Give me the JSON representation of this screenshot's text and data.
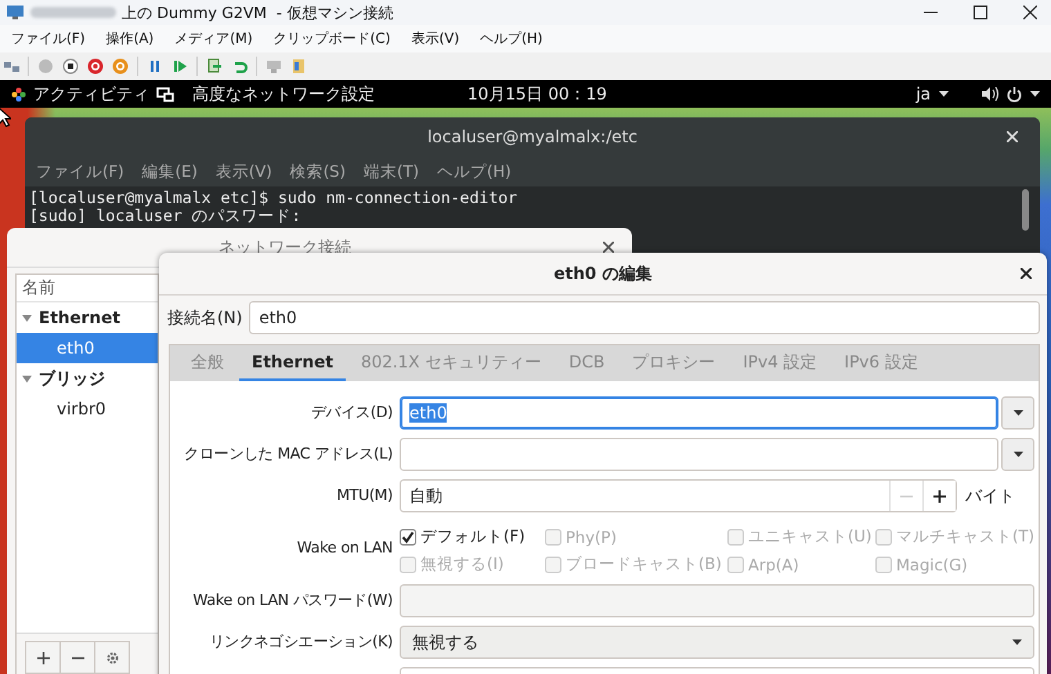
{
  "host_window": {
    "title": "上の Dummy G2VM  - 仮想マシン接続",
    "menu": [
      "ファイル(F)",
      "操作(A)",
      "メディア(M)",
      "クリップボード(C)",
      "表示(V)",
      "ヘルプ(H)"
    ]
  },
  "vm_top_bar": {
    "activities": "アクティビティ",
    "app": "高度なネットワーク設定",
    "clock": "10月15日 00：19",
    "input_method": "ja"
  },
  "terminal": {
    "title": "localuser@myalmalx:/etc",
    "menu": [
      "ファイル(F)",
      "編集(E)",
      "表示(V)",
      "検索(S)",
      "端末(T)",
      "ヘルプ(H)"
    ],
    "lines": [
      "[localuser@myalmalx etc]$ sudo nm-connection-editor",
      "[sudo] localuser のパスワード:"
    ]
  },
  "connections_window": {
    "title": "ネットワーク接続",
    "column": "名前",
    "groups": [
      {
        "label": "Ethernet",
        "expanded": true,
        "children": [
          {
            "label": "eth0",
            "selected": true
          }
        ]
      },
      {
        "label": "ブリッジ",
        "expanded": true,
        "children": [
          {
            "label": "virbr0",
            "selected": false
          }
        ]
      }
    ]
  },
  "edit_dialog": {
    "title": "eth0 の編集",
    "name_label": "接続名(N)",
    "name_value": "eth0",
    "tabs": [
      {
        "label": "全般",
        "selected": false
      },
      {
        "label": "Ethernet",
        "selected": true
      },
      {
        "label": "802.1X セキュリティー",
        "selected": false
      },
      {
        "label": "DCB",
        "selected": false
      },
      {
        "label": "プロキシー",
        "selected": false
      },
      {
        "label": "IPv4 設定",
        "selected": false
      },
      {
        "label": "IPv6 設定",
        "selected": false
      }
    ],
    "fields": [
      {
        "kind": "combo",
        "label": "デバイス(D)",
        "value": "eth0",
        "focused": true
      },
      {
        "kind": "combo",
        "label": "クローンした MAC アドレス(L)",
        "focused": false
      },
      {
        "kind": "spin",
        "label": "MTU(M)",
        "value": "自動",
        "unit": "バイト",
        "decrement_disabled": true
      },
      {
        "kind": "checks",
        "label": "Wake on LAN",
        "options": [
          {
            "label": "デフォルト(F)",
            "checked": true,
            "disabled": false
          },
          {
            "label": "Phy(P)",
            "checked": false,
            "disabled": true
          },
          {
            "label": "ユニキャスト(U)",
            "checked": false,
            "disabled": true
          },
          {
            "label": "マルチキャスト(T)",
            "checked": false,
            "disabled": true
          },
          {
            "label": "無視する(I)",
            "checked": false,
            "disabled": true
          },
          {
            "label": "ブロードキャスト(B)",
            "checked": false,
            "disabled": true
          },
          {
            "label": "Arp(A)",
            "checked": false,
            "disabled": true
          },
          {
            "label": "Magic(G)",
            "checked": false,
            "disabled": true
          }
        ]
      },
      {
        "kind": "text",
        "label": "Wake on LAN パスワード(W)",
        "disabled": true
      },
      {
        "kind": "select",
        "label": "リンクネゴシエーション(K)",
        "value": "無視する"
      },
      {
        "kind": "text"
      }
    ]
  }
}
